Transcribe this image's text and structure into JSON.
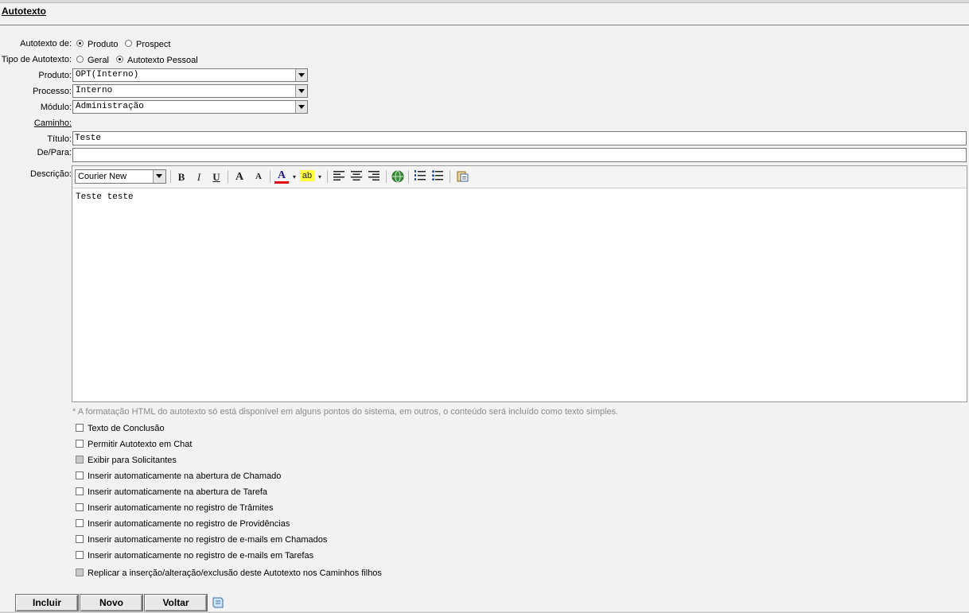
{
  "page": {
    "title": "Autotexto"
  },
  "autotexto_de": {
    "label": "Autotexto de:",
    "options": [
      {
        "label": "Produto",
        "checked": true
      },
      {
        "label": "Prospect",
        "checked": false
      }
    ]
  },
  "tipo_autotexto": {
    "label": "Tipo de Autotexto:",
    "options": [
      {
        "label": "Geral",
        "checked": false
      },
      {
        "label": "Autotexto Pessoal",
        "checked": true
      }
    ]
  },
  "produto": {
    "label": "Produto:",
    "value": "OPT(Interno)"
  },
  "processo": {
    "label": "Processo:",
    "value": "Interno"
  },
  "modulo": {
    "label": "Módulo:",
    "value": "Administração"
  },
  "caminho": {
    "label": "Caminho:"
  },
  "titulo": {
    "label": "Título:",
    "value": "Teste"
  },
  "de_para": {
    "label": "De/Para:",
    "value": ""
  },
  "descricao": {
    "label": "Descrição:",
    "font": "Courier New",
    "toolbar": {
      "bold": "B",
      "italic": "I",
      "underline": "U",
      "grow": "A",
      "shrink": "A",
      "color": "A",
      "highlight": "ab"
    },
    "content": "Teste teste"
  },
  "note": "* A formatação HTML do autotexto só está disponível em alguns pontos do sistema, em outros, o conteúdo será incluído como texto simples.",
  "checkboxes": [
    {
      "label": "Texto de Conclusão",
      "checked": false,
      "disabled": false
    },
    {
      "label": "Permitir Autotexto em Chat",
      "checked": false,
      "disabled": false
    },
    {
      "label": "Exibir para Solicitantes",
      "checked": false,
      "disabled": true
    },
    {
      "label": "Inserir automaticamente na abertura de Chamado",
      "checked": false,
      "disabled": false
    },
    {
      "label": "Inserir automaticamente na abertura de Tarefa",
      "checked": false,
      "disabled": false
    },
    {
      "label": "Inserir automaticamente no registro de Trâmites",
      "checked": false,
      "disabled": false
    },
    {
      "label": "Inserir automaticamente no registro de Providências",
      "checked": false,
      "disabled": false
    },
    {
      "label": "Inserir automaticamente no registro de e-mails em Chamados",
      "checked": false,
      "disabled": false
    },
    {
      "label": "Inserir automaticamente no registro de e-mails em Tarefas",
      "checked": false,
      "disabled": false
    },
    {
      "label": "Replicar a inserção/alteração/exclusão deste Autotexto nos Caminhos filhos",
      "checked": false,
      "disabled": true
    }
  ],
  "buttons": {
    "incluir": "Incluir",
    "novo": "Novo",
    "voltar": "Voltar"
  },
  "icons": {
    "link": "globe-link-icon",
    "ordered_list": "numbered-list-icon",
    "bullet_list": "bullet-list-icon",
    "paste": "paste-word-icon",
    "help": "document-help-icon"
  }
}
